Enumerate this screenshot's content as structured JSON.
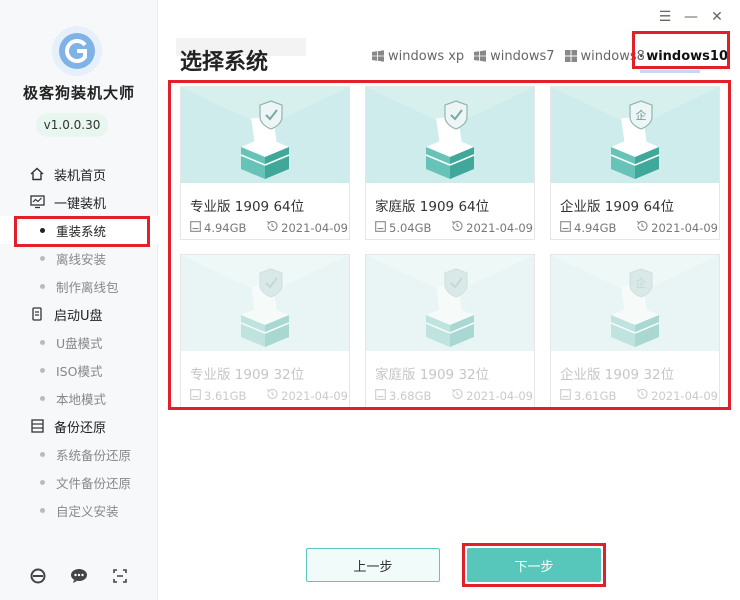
{
  "app": {
    "name": "极客狗装机大师",
    "version": "v1.0.0.30"
  },
  "sidebar": {
    "items": [
      {
        "label": "装机首页",
        "type": "main",
        "icon": "home-icon"
      },
      {
        "label": "一键装机",
        "type": "main",
        "icon": "monitor-icon"
      },
      {
        "label": "重装系统",
        "type": "sub",
        "active": true
      },
      {
        "label": "离线安装",
        "type": "sub"
      },
      {
        "label": "制作离线包",
        "type": "sub"
      },
      {
        "label": "启动U盘",
        "type": "main",
        "icon": "usb-icon"
      },
      {
        "label": "U盘模式",
        "type": "sub"
      },
      {
        "label": "ISO模式",
        "type": "sub"
      },
      {
        "label": "本地模式",
        "type": "sub"
      },
      {
        "label": "备份还原",
        "type": "main",
        "icon": "backup-icon"
      },
      {
        "label": "系统备份还原",
        "type": "sub"
      },
      {
        "label": "文件备份还原",
        "type": "sub"
      },
      {
        "label": "自定义安装",
        "type": "sub"
      }
    ],
    "footer_icons": [
      "browser-icon",
      "chat-icon",
      "scan-icon"
    ]
  },
  "header": {
    "title": "选择系统",
    "tabs": [
      "windows xp",
      "windows7",
      "windows8",
      "windows10"
    ],
    "active_tab": "windows10"
  },
  "systems": [
    {
      "name": "专业版 1909 64位",
      "size": "4.94GB",
      "date": "2021-04-09",
      "badge": "check"
    },
    {
      "name": "家庭版 1909 64位",
      "size": "5.04GB",
      "date": "2021-04-09",
      "badge": "check"
    },
    {
      "name": "企业版 1909 64位",
      "size": "4.94GB",
      "date": "2021-04-09",
      "badge": "企"
    },
    {
      "name": "专业版 1909 32位",
      "size": "3.61GB",
      "date": "2021-04-09",
      "badge": "check"
    },
    {
      "name": "家庭版 1909 32位",
      "size": "3.68GB",
      "date": "2021-04-09",
      "badge": "check"
    },
    {
      "name": "企业版 1909 32位",
      "size": "3.61GB",
      "date": "2021-04-09",
      "badge": "企"
    }
  ],
  "buttons": {
    "prev": "上一步",
    "next": "下一步"
  },
  "colors": {
    "accent": "#58c7bb",
    "highlight": "#e2202a"
  }
}
